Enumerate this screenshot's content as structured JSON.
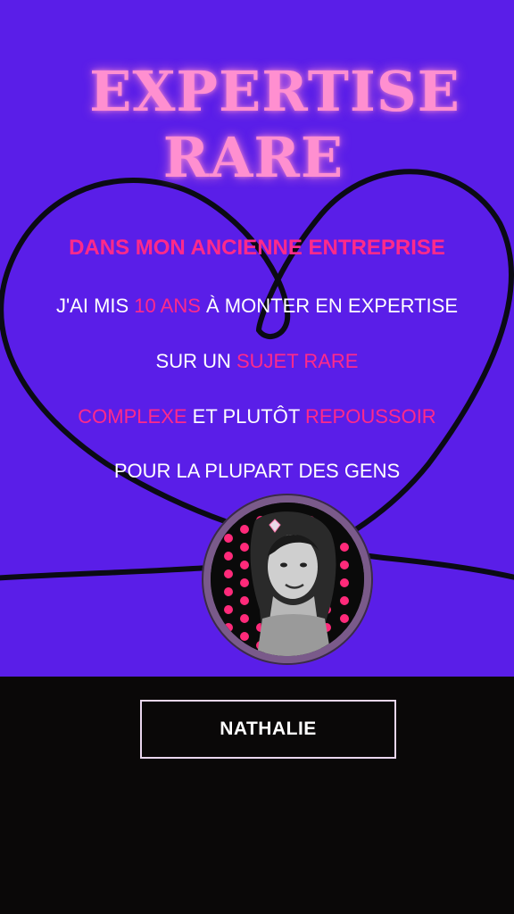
{
  "hero": {
    "title_line1": "EXPERTISE",
    "title_line2": "RARE"
  },
  "body": {
    "line1": "DANS MON ANCIENNE ENTREPRISE",
    "line2": {
      "a": "J'AI MIS ",
      "b": "10 ANS",
      "c": " À MONTER EN EXPERTISE"
    },
    "line3": {
      "a": "SUR UN ",
      "b": "SUJET RARE"
    },
    "line4": {
      "a": "COMPLEXE",
      "b": " ET PLUTÔT ",
      "c": "REPOUSSOIR"
    },
    "line5": "POUR LA PLUPART DES GENS"
  },
  "profile": {
    "avatar_icon": "portrait-photo"
  },
  "cta": {
    "name_label": "NATHALIE"
  },
  "colors": {
    "purple_bg": "#5a1ee8",
    "black_bg": "#0a0808",
    "title_pink": "#ff8fd0",
    "accent_pink": "#ff2a8a"
  }
}
